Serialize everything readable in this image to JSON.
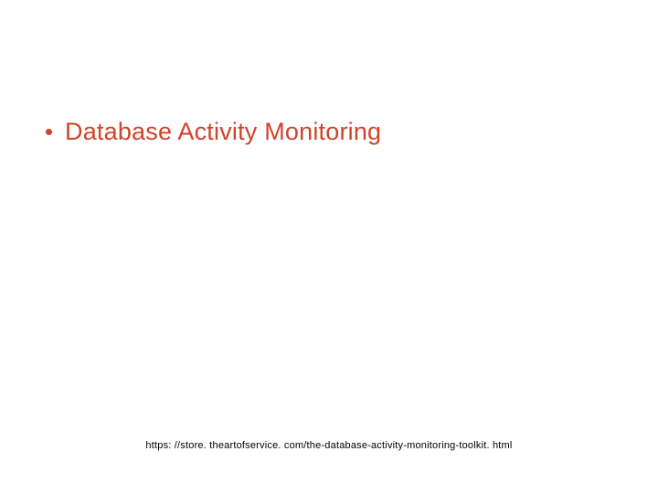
{
  "slide": {
    "bullets": [
      {
        "text": "Database Activity Monitoring"
      }
    ],
    "footer_url": "https: //store. theartofservice. com/the-database-activity-monitoring-toolkit. html"
  }
}
